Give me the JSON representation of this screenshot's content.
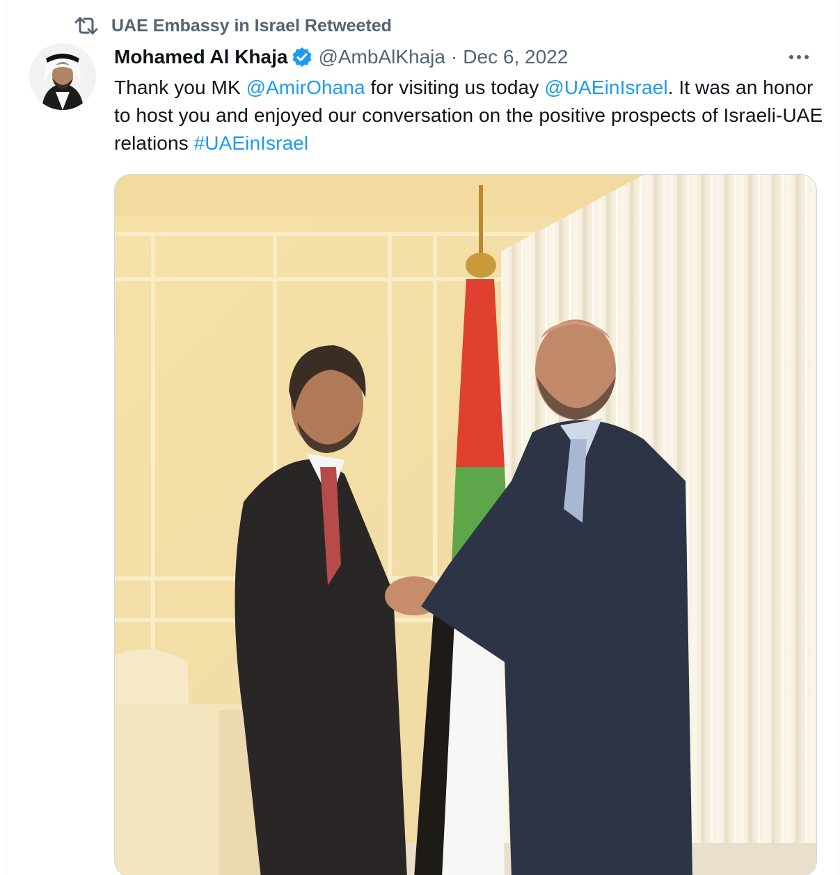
{
  "retweet": {
    "icon": "retweet-icon",
    "text": "UAE Embassy in Israel Retweeted"
  },
  "author": {
    "name": "Mohamed Al Khaja",
    "verified_icon": "verified-badge-icon",
    "handle": "@AmbAlKhaja",
    "separator": "·",
    "date": "Dec 6, 2022"
  },
  "more_icon": "more-options-icon",
  "tweet": {
    "segments": [
      {
        "text": "Thank you MK ",
        "link": false
      },
      {
        "text": "@AmirOhana",
        "link": true
      },
      {
        "text": " for visiting us today ",
        "link": false
      },
      {
        "text": "@UAEinIsrael",
        "link": true
      },
      {
        "text": ". It was an honor to host you and enjoyed our conversation on the positive prospects of Israeli-UAE relations ",
        "link": false
      },
      {
        "text": "#UAEinIsrael",
        "link": true
      }
    ]
  },
  "colors": {
    "link": "#1d9bf0",
    "secondary_text": "#536471",
    "verified": "#1d9bf0"
  }
}
